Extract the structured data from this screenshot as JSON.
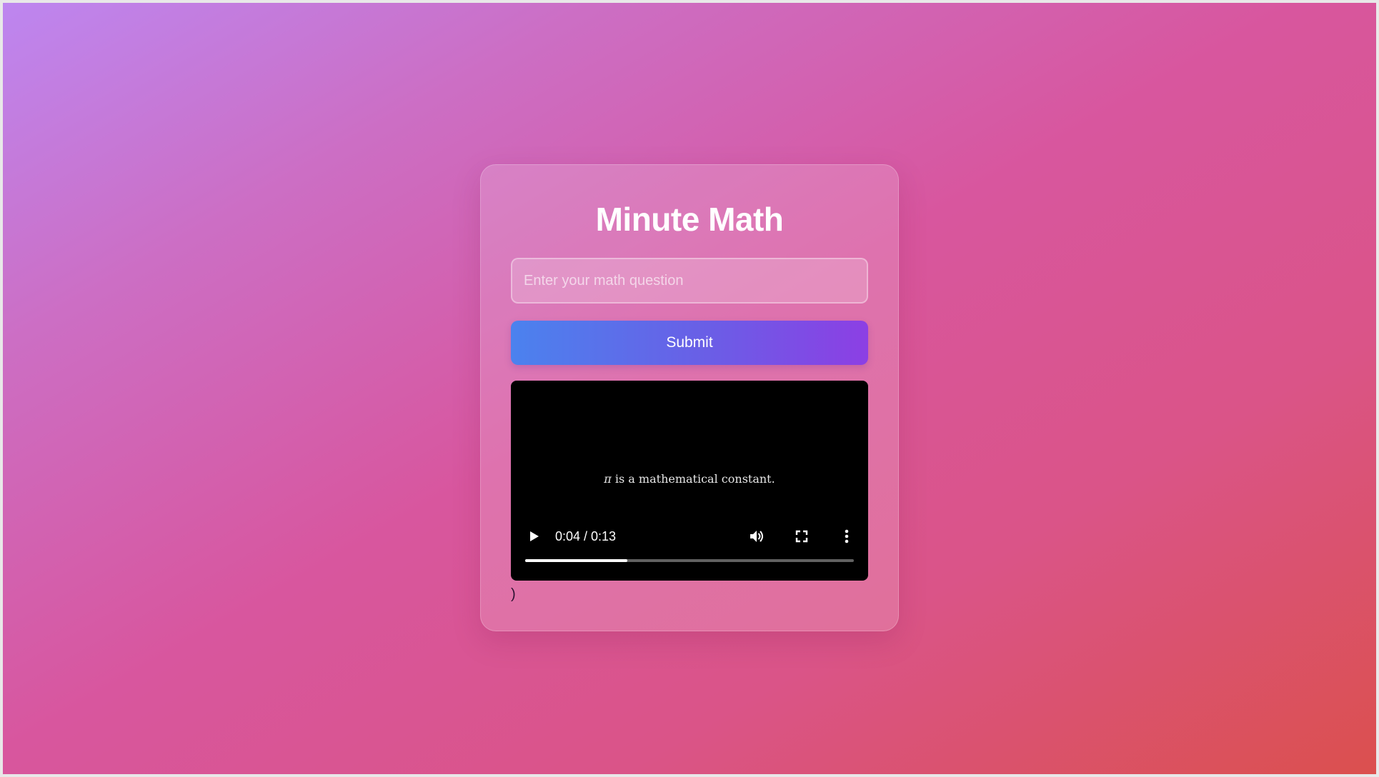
{
  "app": {
    "title": "Minute Math"
  },
  "question_input": {
    "value": "",
    "placeholder": "Enter your math question"
  },
  "submit_button": {
    "label": "Submit"
  },
  "video": {
    "caption_symbol": "π",
    "caption_text": " is a mathematical constant.",
    "time_display": "0:04 / 0:13",
    "progress_fraction": 0.31,
    "icons": [
      "play-icon",
      "volume-icon",
      "fullscreen-icon",
      "more-options-icon"
    ]
  },
  "stray_text": ")",
  "colors": {
    "submit_gradient_start": "#4b82ee",
    "submit_gradient_end": "#8c3fe4",
    "background_top_left": "#bd86f0",
    "background_bottom_right": "#db504e"
  }
}
